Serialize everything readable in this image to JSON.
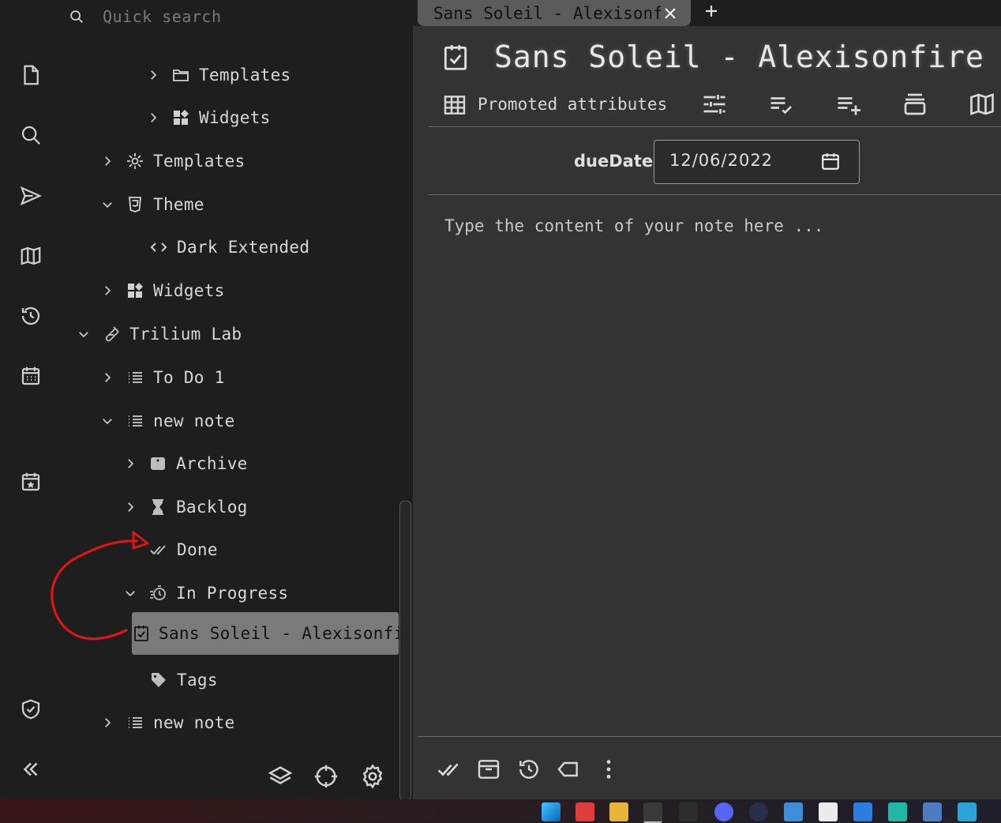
{
  "search": {
    "placeholder": "Quick search"
  },
  "tree": {
    "items": [
      {
        "label": "Templates",
        "icon": "folder-open-icon"
      },
      {
        "label": "Widgets",
        "icon": "widgets-icon"
      },
      {
        "label": "Templates",
        "icon": "templates-gear-icon"
      },
      {
        "label": "Theme",
        "icon": "css-icon"
      },
      {
        "label": "Dark Extended",
        "icon": "code-icon"
      },
      {
        "label": "Widgets",
        "icon": "widgets-icon"
      },
      {
        "label": "Trilium Lab",
        "icon": "test-tube-icon"
      },
      {
        "label": "To Do 1",
        "icon": "list-icon"
      },
      {
        "label": "new note",
        "icon": "list-icon"
      },
      {
        "label": "Archive",
        "icon": "archive-icon"
      },
      {
        "label": "Backlog",
        "icon": "hourglass-icon"
      },
      {
        "label": "Done",
        "icon": "double-check-icon"
      },
      {
        "label": "In Progress",
        "icon": "timer-icon"
      },
      {
        "label": "Sans Soleil - Alexisonfire",
        "icon": "checkbox-icon"
      },
      {
        "label": "Tags",
        "icon": "tag-icon"
      },
      {
        "label": "new note",
        "icon": "list-icon"
      }
    ]
  },
  "tab": {
    "title": "Sans Soleil - Alexisonfire"
  },
  "note": {
    "title": "Sans Soleil - Alexisonfire",
    "ribbon": {
      "promoted_label": "Promoted attributes"
    },
    "attributes": {
      "due_label": "dueDate",
      "due_value": "12/06/2022"
    },
    "content_placeholder": "Type the content of your note here ..."
  },
  "colors": {
    "annotation": "#e01515",
    "active_bg": "#7a7a7a",
    "panel_bg": "#333333",
    "sidebar_bg": "#1e1e1e"
  }
}
